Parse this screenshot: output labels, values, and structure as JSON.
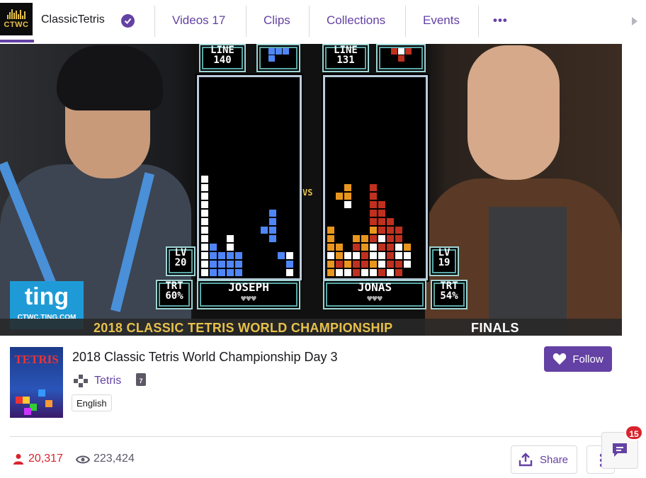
{
  "nav": {
    "logo_text": "CTWC",
    "channel_name": "ClassicTetris",
    "tabs": [
      {
        "label": "Videos",
        "count": "17"
      },
      {
        "label": "Clips"
      },
      {
        "label": "Collections"
      },
      {
        "label": "Events"
      }
    ],
    "more": "•••"
  },
  "video": {
    "left_player": {
      "lines_label": "LINE",
      "lines": "140",
      "level_label": "LV",
      "level": "20",
      "trt_label": "TRT",
      "trt": "60%",
      "name": "JOSEPH"
    },
    "right_player": {
      "lines_label": "LINE",
      "lines": "131",
      "level_label": "LV",
      "level": "19",
      "trt_label": "TRT",
      "trt": "54%",
      "name": "JONAS"
    },
    "vs": "VS",
    "hearts": "♥♥♥",
    "sponsor": {
      "word": "ting",
      "url": "CTWC.TING.COM"
    },
    "banner": {
      "title": "2018 CLASSIC TETRIS WORLD CHAMPIONSHIP",
      "stage": "FINALS"
    },
    "colors": {
      "left_piece": "#4f86f7",
      "right_orange": "#e8961e",
      "right_red": "#c0301e",
      "board_border": "#9fd4d4"
    }
  },
  "info": {
    "boxart_title": "TETRIS",
    "stream_title": "2018 Classic Tetris World Championship Day 3",
    "game": "Tetris",
    "rating": "7",
    "language": "English",
    "follow_label": "Follow",
    "viewer_count": "20,317",
    "view_count": "223,424",
    "share_label": "Share",
    "chat_badge": "15"
  },
  "theme": {
    "accent": "#6441a4",
    "live_red": "#d9232c"
  }
}
